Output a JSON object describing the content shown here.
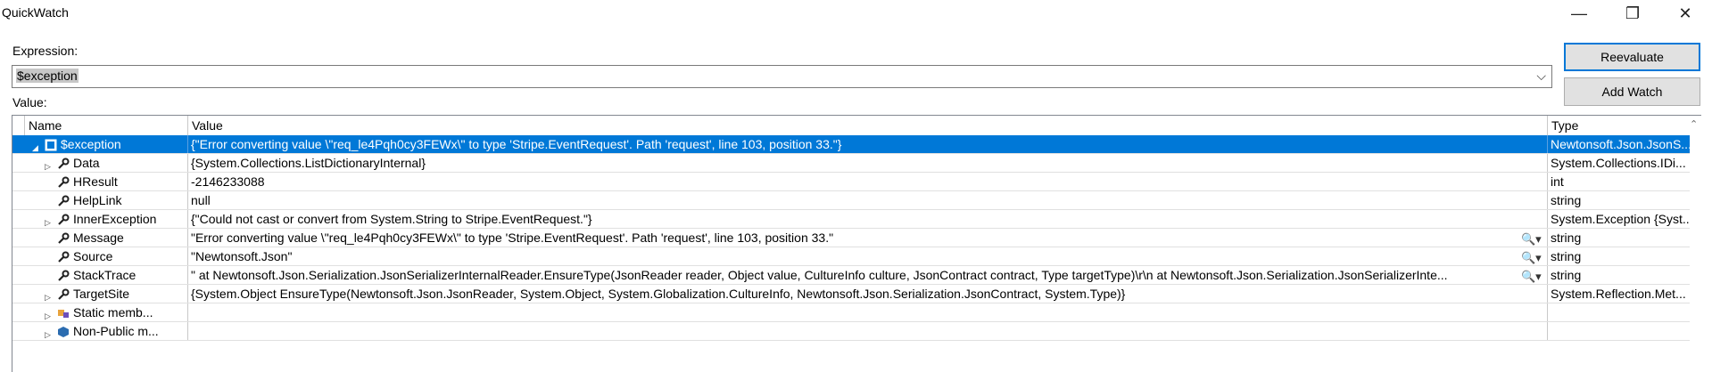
{
  "window": {
    "title": "QuickWatch",
    "minimize_glyph": "—",
    "restore_glyph": "❐",
    "close_glyph": "✕"
  },
  "expression": {
    "label": "Expression:",
    "value": "$exception",
    "dropdown_glyph": "⌵"
  },
  "buttons": {
    "reevaluate": "Reevaluate",
    "add_watch": "Add Watch"
  },
  "value_label": "Value:",
  "columns": {
    "name": "Name",
    "value": "Value",
    "type": "Type"
  },
  "rows": [
    {
      "name": "$exception",
      "value": "{\"Error converting value \\\"req_le4Pqh0cy3FEWx\\\" to type 'Stripe.EventRequest'. Path 'request', line 103, position 33.\"}",
      "type": "Newtonsoft.Json.JsonS...",
      "expander": "◢",
      "icon": "object-icon"
    },
    {
      "name": "Data",
      "value": "{System.Collections.ListDictionaryInternal}",
      "type": "System.Collections.IDi...",
      "expander": "▷",
      "icon": "wrench-icon"
    },
    {
      "name": "HResult",
      "value": "-2146233088",
      "type": "int",
      "expander": "",
      "icon": "wrench-icon"
    },
    {
      "name": "HelpLink",
      "value": "null",
      "type": "string",
      "expander": "",
      "icon": "wrench-icon"
    },
    {
      "name": "InnerException",
      "value": "{\"Could not cast or convert from System.String to Stripe.EventRequest.\"}",
      "type": "System.Exception {Syst...",
      "expander": "▷",
      "icon": "wrench-icon"
    },
    {
      "name": "Message",
      "value": "\"Error converting value \\\"req_le4Pqh0cy3FEWx\\\" to type 'Stripe.EventRequest'. Path 'request', line 103, position 33.\"",
      "type": "string",
      "expander": "",
      "icon": "wrench-icon",
      "viewer": "🔍▾"
    },
    {
      "name": "Source",
      "value": "\"Newtonsoft.Json\"",
      "type": "string",
      "expander": "",
      "icon": "wrench-icon",
      "viewer": "🔍▾"
    },
    {
      "name": "StackTrace",
      "value": "\"   at Newtonsoft.Json.Serialization.JsonSerializerInternalReader.EnsureType(JsonReader reader, Object value, CultureInfo culture, JsonContract contract, Type targetType)\\r\\n   at Newtonsoft.Json.Serialization.JsonSerializerInte...",
      "type": "string",
      "expander": "",
      "icon": "wrench-icon",
      "viewer": "🔍▾"
    },
    {
      "name": "TargetSite",
      "value": "{System.Object EnsureType(Newtonsoft.Json.JsonReader, System.Object, System.Globalization.CultureInfo, Newtonsoft.Json.Serialization.JsonContract, System.Type)}",
      "type": "System.Reflection.Met...",
      "expander": "▷",
      "icon": "wrench-icon"
    },
    {
      "name": "Static memb...",
      "value": "",
      "type": "",
      "expander": "▷",
      "icon": "static-members-icon"
    },
    {
      "name": "Non-Public m...",
      "value": "",
      "type": "",
      "expander": "▷",
      "icon": "non-public-icon"
    }
  ],
  "scroll_up_glyph": "⌃",
  "colors": {
    "selection": "#0078d7",
    "button_border": "#0078d7"
  }
}
